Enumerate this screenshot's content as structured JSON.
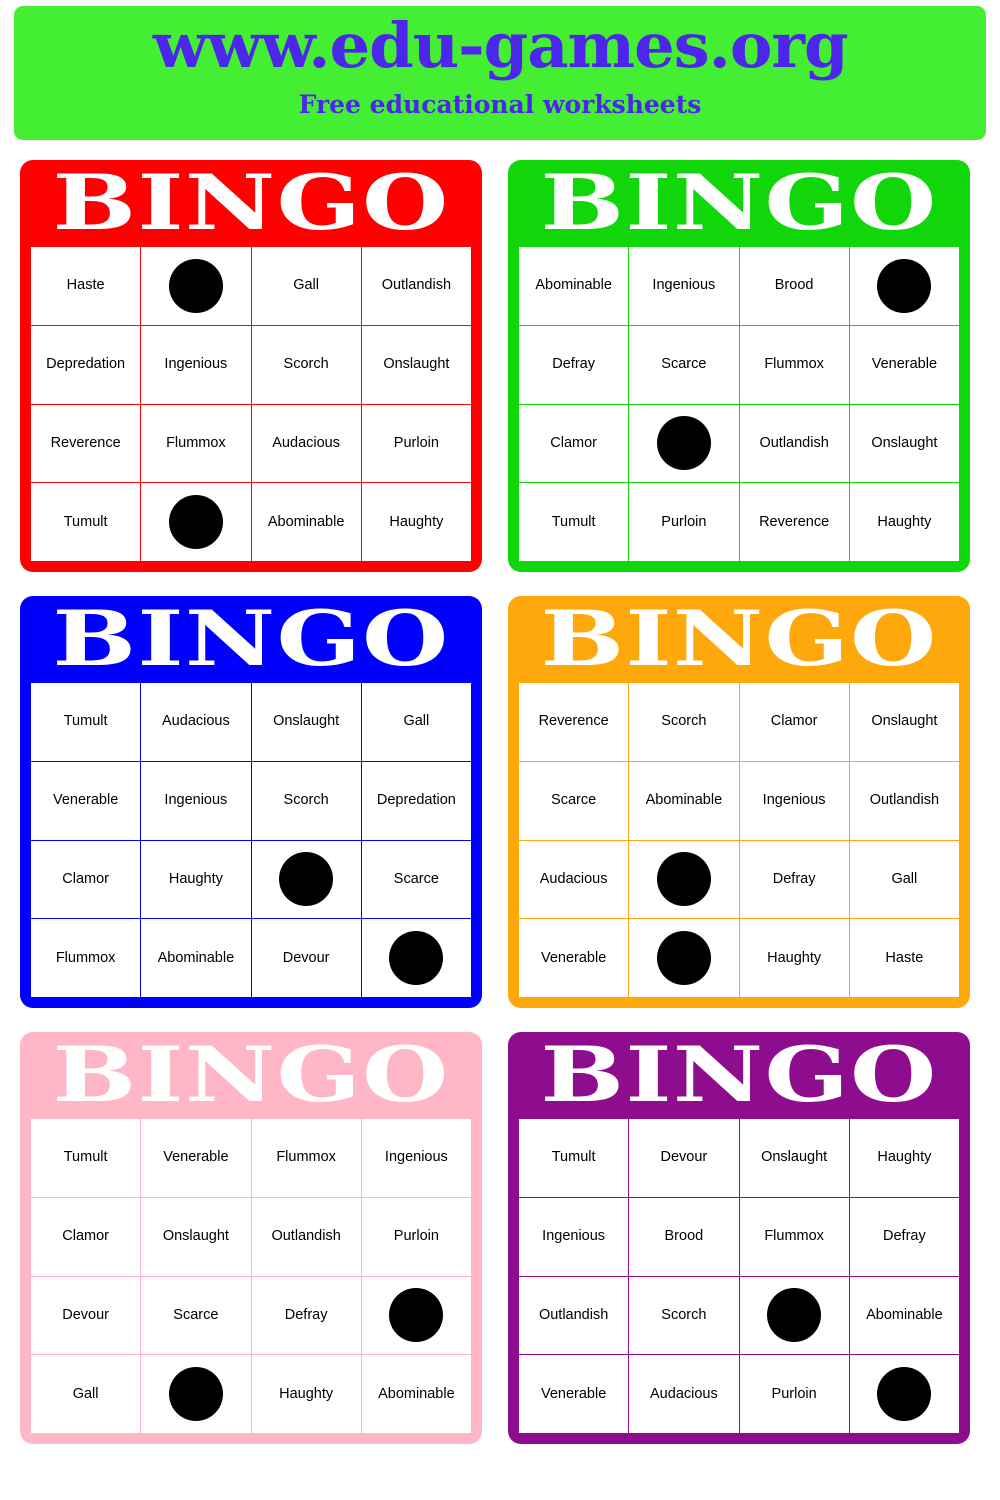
{
  "header": {
    "title": "www.edu-games.org",
    "subtitle": "Free educational worksheets"
  },
  "cards": [
    {
      "id": "card-red",
      "title": "BINGO",
      "color": "#ff0000",
      "cells": [
        "Haste",
        "",
        "Gall",
        "Outlandish",
        "Depredation",
        "Ingenious",
        "Scorch",
        "Onslaught",
        "Reverence",
        "Flummox",
        "Audacious",
        "Purloin",
        "Tumult",
        "",
        "Abominable",
        "Haughty"
      ],
      "free_indices": [
        1,
        13
      ]
    },
    {
      "id": "card-green",
      "title": "BINGO",
      "color": "#11d60a",
      "cells": [
        "Abominable",
        "Ingenious",
        "Brood",
        "",
        "Defray",
        "Scarce",
        "Flummox",
        "Venerable",
        "Clamor",
        "",
        "Outlandish",
        "Onslaught",
        "Tumult",
        "Purloin",
        "Reverence",
        "Haughty"
      ],
      "free_indices": [
        3,
        9
      ]
    },
    {
      "id": "card-blue",
      "title": "BINGO",
      "color": "#0000ff",
      "cells": [
        "Tumult",
        "Audacious",
        "Onslaught",
        "Gall",
        "Venerable",
        "Ingenious",
        "Scorch",
        "Depredation",
        "Clamor",
        "Haughty",
        "",
        "Scarce",
        "Flummox",
        "Abominable",
        "Devour",
        ""
      ],
      "free_indices": [
        10,
        15
      ]
    },
    {
      "id": "card-orange",
      "title": "BINGO",
      "color": "#ffa80c",
      "cells": [
        "Reverence",
        "Scorch",
        "Clamor",
        "Onslaught",
        "Scarce",
        "Abominable",
        "Ingenious",
        "Outlandish",
        "Audacious",
        "",
        "Defray",
        "Gall",
        "Venerable",
        "",
        "Haughty",
        "Haste"
      ],
      "free_indices": [
        9,
        13
      ]
    },
    {
      "id": "card-pink",
      "title": "BINGO",
      "color": "#ffb6c6",
      "cells": [
        "Tumult",
        "Venerable",
        "Flummox",
        "Ingenious",
        "Clamor",
        "Onslaught",
        "Outlandish",
        "Purloin",
        "Devour",
        "Scarce",
        "Defray",
        "",
        "Gall",
        "",
        "Haughty",
        "Abominable"
      ],
      "free_indices": [
        11,
        13
      ]
    },
    {
      "id": "card-purple",
      "title": "BINGO",
      "color": "#8e0d8e",
      "cells": [
        "Tumult",
        "Devour",
        "Onslaught",
        "Haughty",
        "Ingenious",
        "Brood",
        "Flummox",
        "Defray",
        "Outlandish",
        "Scorch",
        "",
        "Abominable",
        "Venerable",
        "Audacious",
        "Purloin",
        ""
      ],
      "free_indices": [
        10,
        15
      ]
    }
  ]
}
